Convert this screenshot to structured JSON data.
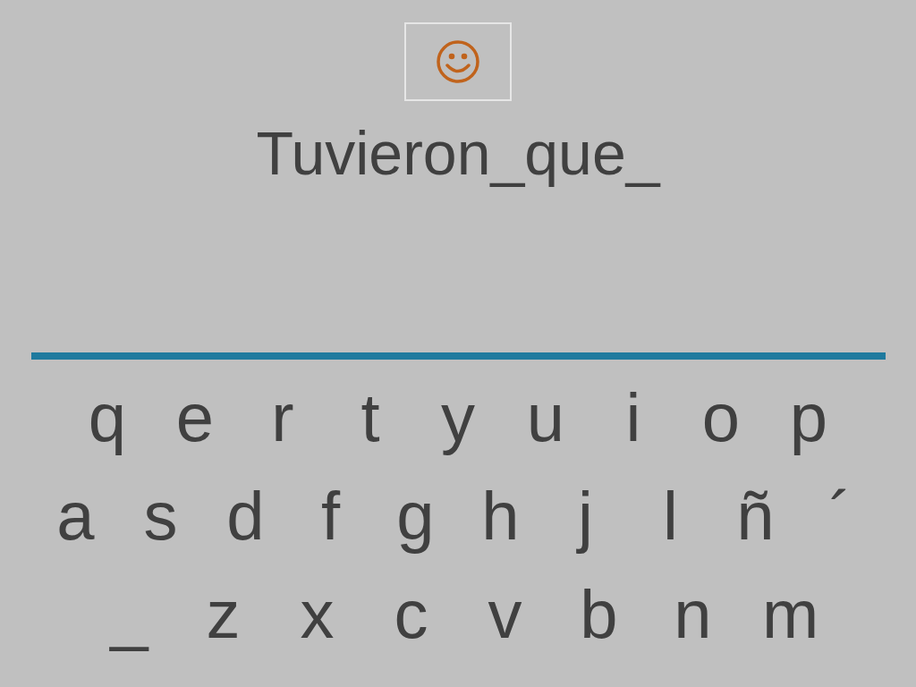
{
  "sentence": "Tuvieron_que_",
  "keyboard": {
    "rows": [
      [
        "q",
        "e",
        "r",
        "t",
        "y",
        "u",
        "i",
        "o",
        "p"
      ],
      [
        "a",
        "s",
        "d",
        "f",
        "g",
        "h",
        "j",
        "l",
        "ñ",
        "´"
      ],
      [
        "_",
        "z",
        "x",
        "c",
        "v",
        "b",
        "n",
        "m"
      ]
    ]
  }
}
